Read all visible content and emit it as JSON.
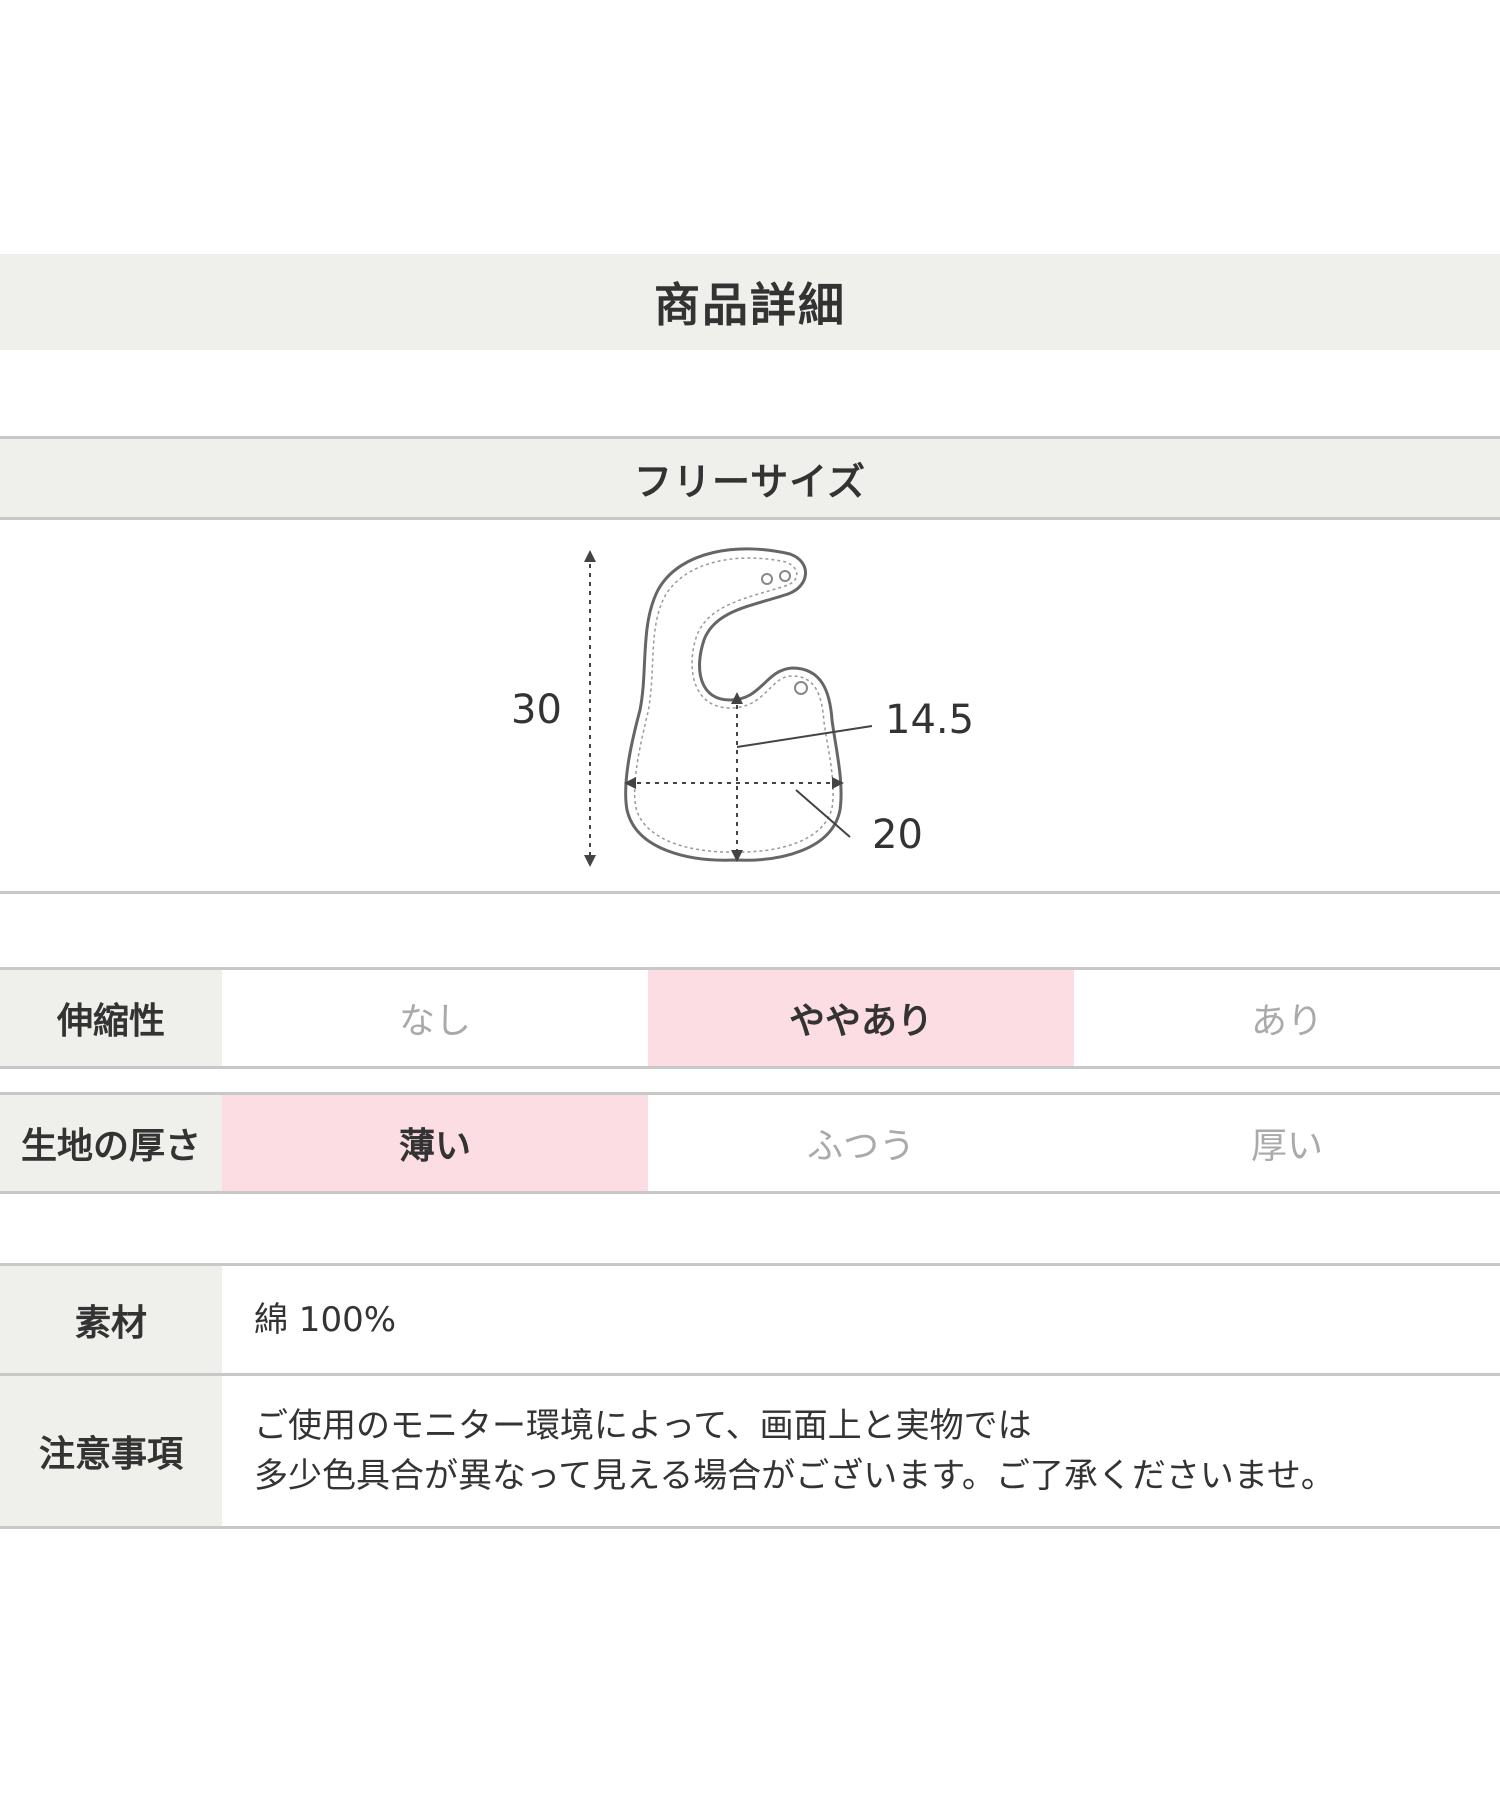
{
  "title": "商品詳細",
  "size": {
    "label": "フリーサイズ",
    "dimensions": {
      "length": "30",
      "neck": "14.5",
      "width": "20"
    }
  },
  "stretch": {
    "label": "伸縮性",
    "options": [
      "なし",
      "ややあり",
      "あり"
    ],
    "selected": "ややあり"
  },
  "thickness": {
    "label": "生地の厚さ",
    "options": [
      "薄い",
      "ふつう",
      "厚い"
    ],
    "selected": "薄い"
  },
  "material": {
    "label": "素材",
    "value": "綿 100%"
  },
  "notes": {
    "label": "注意事項",
    "lines": [
      "ご使用のモニター環境によって、画面上と実物では",
      "多少色具合が異なって見える場合がございます。ご了承くださいませ。"
    ]
  },
  "colors": {
    "band": "#efefec",
    "highlight": "#fcdde3",
    "rule": "#c8c8c8",
    "muted": "#aaaaaa",
    "text": "#333333"
  }
}
